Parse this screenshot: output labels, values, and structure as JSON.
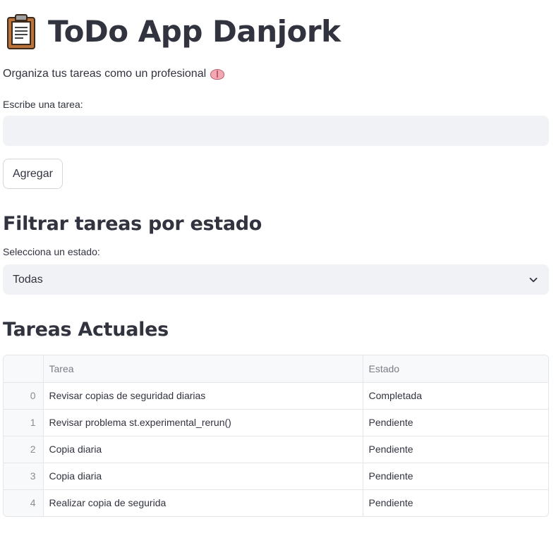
{
  "header": {
    "title": "ToDo App Danjork",
    "title_icon": "clipboard-icon",
    "subtitle": "Organiza tus tareas como un profesional",
    "subtitle_icon": "brain-icon"
  },
  "task_input": {
    "label": "Escribe una tarea:",
    "value": "",
    "placeholder": ""
  },
  "add_button": {
    "label": "Agregar"
  },
  "filter_section": {
    "heading": "Filtrar tareas por estado",
    "select_label": "Selecciona un estado:",
    "selected_value": "Todas"
  },
  "tasks_section": {
    "heading": "Tareas Actuales",
    "columns": [
      "",
      "Tarea",
      "Estado"
    ],
    "rows": [
      {
        "index": "0",
        "tarea": "Revisar copias de seguridad diarias",
        "estado": "Completada"
      },
      {
        "index": "1",
        "tarea": "Revisar problema st.experimental_rerun()",
        "estado": "Pendiente"
      },
      {
        "index": "2",
        "tarea": "Copia diaria",
        "estado": "Pendiente"
      },
      {
        "index": "3",
        "tarea": "Copia diaria",
        "estado": "Pendiente"
      },
      {
        "index": "4",
        "tarea": "Realizar copia de segurida",
        "estado": "Pendiente"
      }
    ]
  },
  "colors": {
    "text": "#31333f",
    "input_bg": "#f0f2f6",
    "border": "#e6e6ea",
    "header_text": "#7b7d86"
  }
}
